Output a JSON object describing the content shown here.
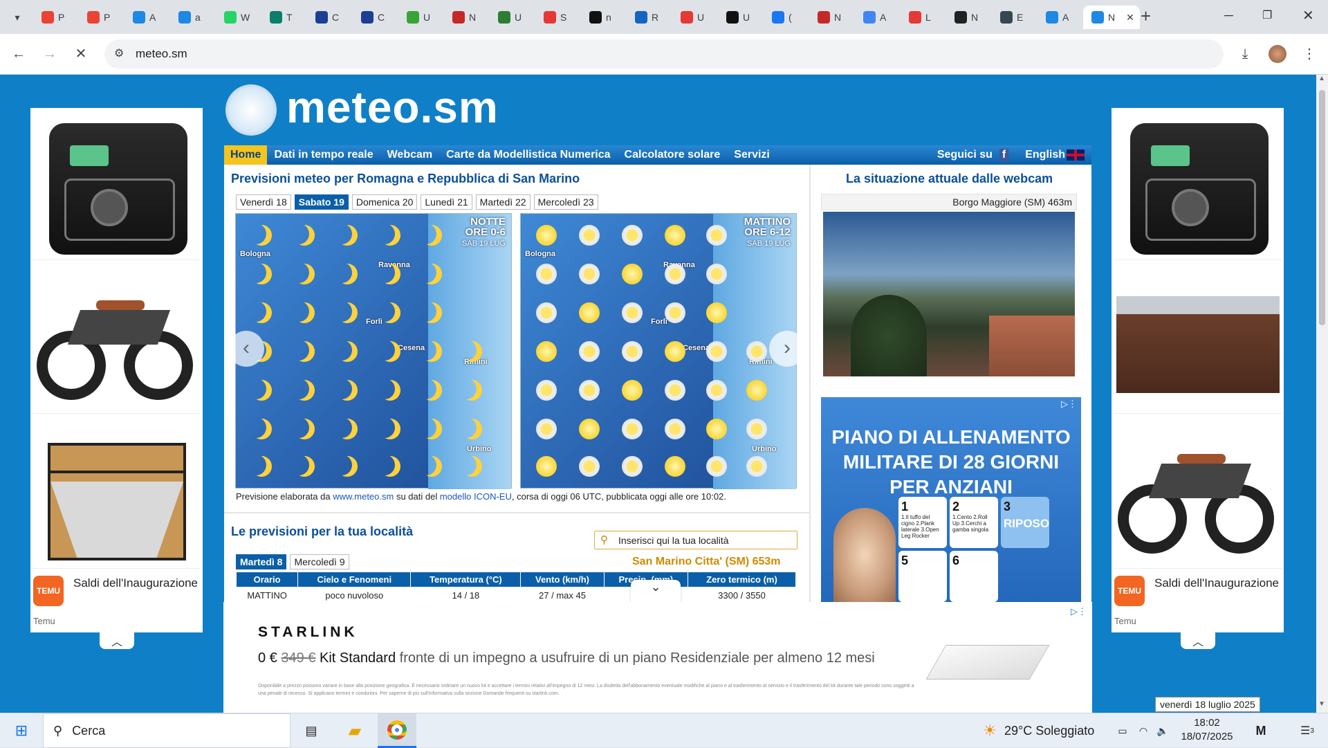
{
  "browser": {
    "tabs": [
      {
        "label": "P",
        "color": "#ea4335"
      },
      {
        "label": "P",
        "color": "#ea4335"
      },
      {
        "label": "A",
        "color": "#1e88e5"
      },
      {
        "label": "a",
        "color": "#1e88e5"
      },
      {
        "label": "W",
        "color": "#25d366"
      },
      {
        "label": "T",
        "color": "#0d7d6c"
      },
      {
        "label": "C",
        "color": "#1c3f94"
      },
      {
        "label": "C",
        "color": "#1c3f94"
      },
      {
        "label": "U",
        "color": "#3aa335"
      },
      {
        "label": "N",
        "color": "#c62828"
      },
      {
        "label": "U",
        "color": "#2e7d32"
      },
      {
        "label": "S",
        "color": "#e53935"
      },
      {
        "label": "n",
        "color": "#111111"
      },
      {
        "label": "R",
        "color": "#1565c0"
      },
      {
        "label": "U",
        "color": "#e53935"
      },
      {
        "label": "U",
        "color": "#111111"
      },
      {
        "label": "(",
        "color": "#1877f2"
      },
      {
        "label": "N",
        "color": "#c62828"
      },
      {
        "label": "A",
        "color": "#4285f4"
      },
      {
        "label": "L",
        "color": "#e53935"
      },
      {
        "label": "N",
        "color": "#222222"
      },
      {
        "label": "E",
        "color": "#37474f"
      },
      {
        "label": "A",
        "color": "#1e88e5"
      },
      {
        "label": "N",
        "color": "#1e88e5"
      }
    ],
    "url": "meteo.sm"
  },
  "site": {
    "logo": "meteo.sm",
    "nav": [
      "Home",
      "Dati in tempo reale",
      "Webcam",
      "Carte da Modellistica Numerica",
      "Calcolatore solare",
      "Servizi"
    ],
    "follow": "Seguici su",
    "english": "English",
    "forecast_title": "Previsioni meteo per Romagna e Repubblica di San Marino",
    "days": [
      "Venerdì 18",
      "Sabato 19",
      "Domenica 20",
      "Lunedì 21",
      "Martedì 22",
      "Mercoledì 23"
    ],
    "map1": {
      "period": "NOTTE",
      "hours": "ORE 0-6",
      "date": "SAB 19 LUG"
    },
    "map2": {
      "period": "MATTINO",
      "hours": "ORE 6-12",
      "date": "SAB 19 LUG"
    },
    "cities": [
      "Bologna",
      "Ravenna",
      "Forlì",
      "Cesena",
      "Rimini",
      "Urbino"
    ],
    "credit_a": "Previsione elaborata da ",
    "credit_link1": "www.meteo.sm",
    "credit_b": " su dati del ",
    "credit_link2": "modello ICON-EU",
    "credit_c": ", corsa di oggi 06 UTC, pubblicata oggi alle ore 10:02.",
    "webcam_title": "La situazione attuale dalle webcam",
    "webcam_location": "Borgo Maggiore (SM) 463m",
    "local_title": "Le previsioni per la tua località",
    "search_placeholder": "Inserisci qui la tua località",
    "local_tabs": [
      "Martedì 8",
      "Mercoledì 9"
    ],
    "location_name": "San Marino Citta' (SM) 653m",
    "table_headers": [
      "Orario",
      "Cielo e Fenomeni",
      "Temperatura (°C)",
      "Vento (km/h)",
      "Precip. (mm)",
      "Zero termico (m)"
    ],
    "table_row": {
      "time": "MATTINO",
      "sky": "poco nuvoloso",
      "temp": "14 / 18",
      "wind": "27 / max 45",
      "zero": "3300 / 3550"
    }
  },
  "ads": {
    "left_caption": "Saldi dell'Inaugurazione",
    "left_brand": "Temu",
    "right_caption": "Saldi dell'Inaugurazione",
    "right_brand": "Temu",
    "middle_headline": "PIANO DI ALLENAMENTO MILITARE DI 28 GIORNI PER ANZIANI",
    "middle_cards": [
      {
        "num": "1",
        "text": "1.Il tuffo del cigno 2.Plank laterale 3.Open Leg Rocker"
      },
      {
        "num": "2",
        "text": "1.Cento 2.Roll Up 3.Cerchi a gamba singola"
      },
      {
        "num": "3",
        "text": "RIPOSO"
      },
      {
        "num": "5",
        "text": ""
      },
      {
        "num": "6",
        "text": ""
      }
    ],
    "bottom_brand": "STARLINK",
    "bottom_price": "0 €",
    "bottom_old_price": "349 €",
    "bottom_product": "Kit Standard",
    "bottom_text": "fronte di un impegno a usufruire di un piano Residenziale per almeno 12 mesi",
    "bottom_fine": "Disponibile a prezzo possono variare in base alla posizione geografica. È necessario ordinare un nuovo kit e accettare i termini relativi all'impegno di 12 mesi. La disdetta dell'abbonamento eventuale modifiche al piano e al trasferimento al servizio e il trasferimento del kit durante tale periodo sono soggetti a una penale di recesso. Si applicano termini e condizioni. Per saperne di più sull'informativa sulla sezione Domande frequenti su starlink.com."
  },
  "tooltip": "venerdì 18 luglio 2025",
  "taskbar": {
    "search": "Cerca",
    "weather": "29°C Soleggiato",
    "time": "18:02",
    "date": "18/07/2025",
    "notifications": "3"
  },
  "colors": {
    "page_bg": "#0f80c7",
    "nav": "#0b5fa8",
    "accent": "#f4c41f"
  }
}
